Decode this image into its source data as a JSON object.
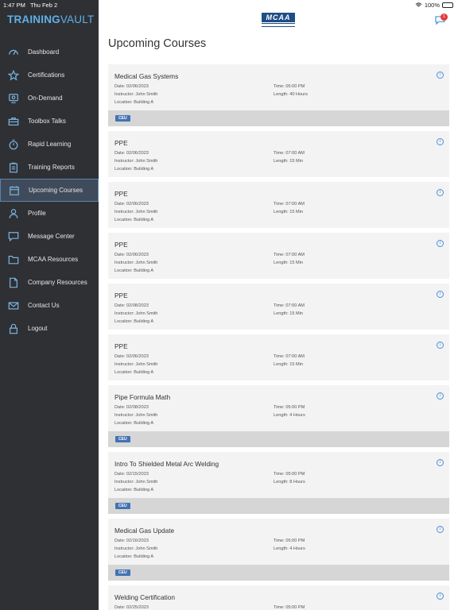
{
  "status": {
    "time": "1:47 PM",
    "date": "Thu Feb 2",
    "battery": "100%"
  },
  "brand": {
    "part1": "TRAINING",
    "part2": "VAULT"
  },
  "logo": {
    "text": "MCAA"
  },
  "messages": {
    "badge": "1"
  },
  "sidebar": {
    "items": [
      {
        "label": "Dashboard",
        "icon": "dashboard-icon"
      },
      {
        "label": "Certifications",
        "icon": "star-icon"
      },
      {
        "label": "On-Demand",
        "icon": "monitor-icon"
      },
      {
        "label": "Toolbox Talks",
        "icon": "toolbox-icon"
      },
      {
        "label": "Rapid Learning",
        "icon": "stopwatch-icon"
      },
      {
        "label": "Training Reports",
        "icon": "clipboard-icon"
      },
      {
        "label": "Upcoming Courses",
        "icon": "calendar-icon",
        "active": true
      },
      {
        "label": "Profile",
        "icon": "user-icon"
      },
      {
        "label": "Message Center",
        "icon": "chat-icon"
      },
      {
        "label": "MCAA Resources",
        "icon": "folder-icon"
      },
      {
        "label": "Company Resources",
        "icon": "document-icon"
      },
      {
        "label": "Contact Us",
        "icon": "mail-icon"
      },
      {
        "label": "Logout",
        "icon": "lock-icon"
      }
    ]
  },
  "page": {
    "title": "Upcoming Courses"
  },
  "courses": [
    {
      "title": "Medical Gas Systems",
      "date": "Date: 02/06/2023",
      "instructor": "Instructor: John Smith",
      "location": "Location: Building A",
      "time": "Time: 05:00 PM",
      "length": "Length: 40 Hours",
      "ceu": "CEU"
    },
    {
      "title": "PPE",
      "date": "Date: 02/06/2023",
      "instructor": "Instructor: John Smith",
      "location": "Location: Building A",
      "time": "Time: 07:00 AM",
      "length": "Length: 15 Min",
      "ceu": ""
    },
    {
      "title": "PPE",
      "date": "Date: 02/06/2023",
      "instructor": "Instructor: John Smith",
      "location": "Location: Building A",
      "time": "Time: 07:00 AM",
      "length": "Length: 15 Min",
      "ceu": ""
    },
    {
      "title": "PPE",
      "date": "Date: 02/06/2023",
      "instructor": "Instructor: John Smith",
      "location": "Location: Building A",
      "time": "Time: 07:00 AM",
      "length": "Length: 15 Min",
      "ceu": ""
    },
    {
      "title": "PPE",
      "date": "Date: 02/08/2023",
      "instructor": "Instructor: John Smith",
      "location": "Location: Building A",
      "time": "Time: 07:00 AM",
      "length": "Length: 15 Min",
      "ceu": ""
    },
    {
      "title": "PPE",
      "date": "Date: 02/06/2023",
      "instructor": "Instructor: John Smith",
      "location": "Location: Building A",
      "time": "Time: 07:00 AM",
      "length": "Length: 15 Min",
      "ceu": ""
    },
    {
      "title": "Pipe Formula Math",
      "date": "Date: 02/08/2023",
      "instructor": "Instructor: John Smith",
      "location": "Location: Building A",
      "time": "Time: 05:00 PM",
      "length": "Length: 4 Hours",
      "ceu": "CEU"
    },
    {
      "title": "Intro To Shielded Metal Arc Welding",
      "date": "Date: 02/15/2023",
      "instructor": "Instructor: John Smith",
      "location": "Location: Building A",
      "time": "Time: 05:00 PM",
      "length": "Length: 8 Hours",
      "ceu": "CEU"
    },
    {
      "title": "Medical Gas Update",
      "date": "Date: 02/16/2023",
      "instructor": "Instructor: John Smith",
      "location": "Location: Building A",
      "time": "Time: 05:00 PM",
      "length": "Length: 4 Hours",
      "ceu": "CEU"
    },
    {
      "title": "Welding Certification",
      "date": "Date: 02/25/2023",
      "instructor": "",
      "location": "",
      "time": "Time: 05:00 PM",
      "length": "",
      "ceu": ""
    }
  ]
}
